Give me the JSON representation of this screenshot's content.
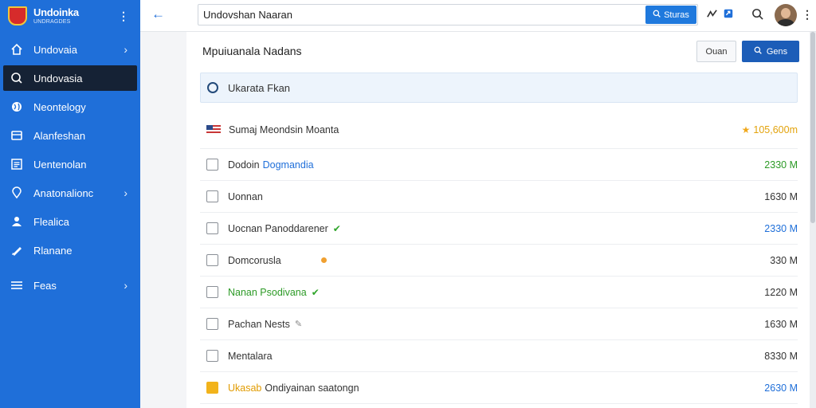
{
  "brand": {
    "title": "Undoinka",
    "subtitle": "UNDRAGDES"
  },
  "sidebar": {
    "more_icon": "kebab-icon",
    "items": [
      {
        "label": "Undovaia",
        "icon": "home-icon",
        "chevron": true,
        "active": false
      },
      {
        "label": "Undovasia",
        "icon": "search-icon",
        "chevron": false,
        "active": true
      },
      {
        "label": "Neontelogy",
        "icon": "globe-icon",
        "chevron": false,
        "active": false
      },
      {
        "label": "Alanfeshan",
        "icon": "monitor-icon",
        "chevron": false,
        "active": false
      },
      {
        "label": "Uentenolan",
        "icon": "list-icon",
        "chevron": false,
        "active": false
      },
      {
        "label": "Anatonalionc",
        "icon": "location-icon",
        "chevron": true,
        "active": false
      },
      {
        "label": "Flealica",
        "icon": "person-icon",
        "chevron": false,
        "active": false
      },
      {
        "label": "Rlanane",
        "icon": "tag-icon",
        "chevron": false,
        "active": false
      },
      {
        "label": "Feas",
        "icon": "menu-icon",
        "chevron": true,
        "active": false
      }
    ]
  },
  "topbar": {
    "search_value": "Undovshan Naaran",
    "search_button": "Sturas"
  },
  "main": {
    "title": "Mpuiuanala Nadans",
    "outline_button": "Ouan",
    "primary_button": "Gens",
    "filter_label": "Ukarata Fkan"
  },
  "rows": [
    {
      "kind": "flag",
      "name": "Sumaj Meondsin Moanta",
      "tag": "",
      "value": "105,600m",
      "value_color": "gold",
      "star": true
    },
    {
      "kind": "cb",
      "name": "Dodoin",
      "tag": "Dogmandia",
      "value": "2330 M",
      "value_color": "green"
    },
    {
      "kind": "cb",
      "name": "Uonnan",
      "tag": "",
      "value": "1630 M",
      "value_color": ""
    },
    {
      "kind": "cb",
      "name": "Uocnan Panoddarener",
      "tag": "",
      "check": true,
      "value": "2330 M",
      "value_color": "blue"
    },
    {
      "kind": "doc",
      "name": "Domcorusla",
      "tag": "",
      "dot": true,
      "value": "330 M",
      "value_color": ""
    },
    {
      "kind": "doc",
      "name": "Nanan Psodivana",
      "name_color": "green",
      "tag": "",
      "check": true,
      "value": "1220 M",
      "value_color": ""
    },
    {
      "kind": "cb",
      "name": "Pachan Nests",
      "tag": "",
      "grey": true,
      "value": "1630 M",
      "value_color": ""
    },
    {
      "kind": "cb",
      "name": "Mentalara",
      "tag": "",
      "value": "8330 M",
      "value_color": ""
    },
    {
      "kind": "yellow",
      "name": "Ukasab",
      "name_color": "amber",
      "tag": "Ondiyainan saatongn",
      "tag_mixed": true,
      "value": "2630 M",
      "value_color": "blue"
    }
  ]
}
